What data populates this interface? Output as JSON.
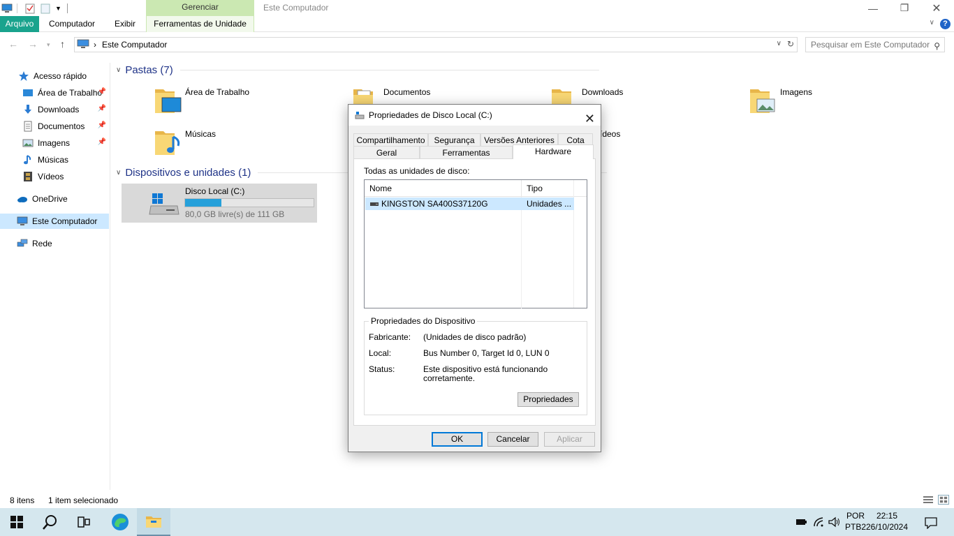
{
  "window": {
    "title": "Este Computador",
    "context_tab_group": "Gerenciar"
  },
  "ribbon": {
    "tabs": [
      "Arquivo",
      "Computador",
      "Exibir",
      "Ferramentas de Unidade"
    ],
    "help": "?"
  },
  "address": {
    "path": "Este Computador",
    "separator": "›",
    "search_placeholder": "Pesquisar em Este Computador"
  },
  "nav": {
    "items": [
      {
        "label": "Acesso rápido",
        "icon": "star-icon",
        "pinned": false
      },
      {
        "label": "Área de Trabalho",
        "icon": "desktop-icon",
        "pinned": true
      },
      {
        "label": "Downloads",
        "icon": "download-arrow-icon",
        "pinned": true
      },
      {
        "label": "Documentos",
        "icon": "document-icon",
        "pinned": true
      },
      {
        "label": "Imagens",
        "icon": "picture-icon",
        "pinned": true
      },
      {
        "label": "Músicas",
        "icon": "music-note-icon",
        "pinned": false
      },
      {
        "label": "Vídeos",
        "icon": "film-icon",
        "pinned": false
      },
      {
        "label": "OneDrive",
        "icon": "cloud-icon",
        "pinned": false
      },
      {
        "label": "Este Computador",
        "icon": "computer-icon",
        "pinned": false
      },
      {
        "label": "Rede",
        "icon": "network-icon",
        "pinned": false
      }
    ]
  },
  "content": {
    "folders_header": "Pastas (7)",
    "folders": [
      "Área de Trabalho",
      "Documentos",
      "Downloads",
      "Imagens",
      "Músicas",
      "Vídeos"
    ],
    "devices_header": "Dispositivos e unidades (1)",
    "drive": {
      "name": "Disco Local (C:)",
      "free_text": "80,0 GB livre(s) de 111 GB",
      "used_fraction": 0.28
    }
  },
  "status": {
    "count": "8 itens",
    "selection": "1 item selecionado"
  },
  "taskbar": {
    "lang_line1": "POR",
    "lang_line2": "PTB2",
    "time": "22:15",
    "date": "26/10/2024"
  },
  "dialog": {
    "title": "Propriedades de Disco Local (C:)",
    "tabs_row1": [
      "Compartilhamento",
      "Segurança",
      "Versões Anteriores",
      "Cota"
    ],
    "tabs_row2": [
      "Geral",
      "Ferramentas",
      "Hardware"
    ],
    "active_tab": "Hardware",
    "all_drives_label": "Todas as unidades de disco:",
    "columns": [
      "Nome",
      "Tipo"
    ],
    "rows": [
      {
        "name": "KINGSTON SA400S37120G",
        "type": "Unidades ..."
      }
    ],
    "device_props_title": "Propriedades do Dispositivo",
    "props": {
      "manufacturer_label": "Fabricante:",
      "manufacturer_value": "(Unidades de disco padrão)",
      "location_label": "Local:",
      "location_value": "Bus Number 0, Target Id 0, LUN 0",
      "status_label": "Status:",
      "status_value_line1": "Este dispositivo está funcionando",
      "status_value_line2": "corretamente."
    },
    "properties_button": "Propriedades",
    "ok": "OK",
    "cancel": "Cancelar",
    "apply": "Aplicar"
  }
}
